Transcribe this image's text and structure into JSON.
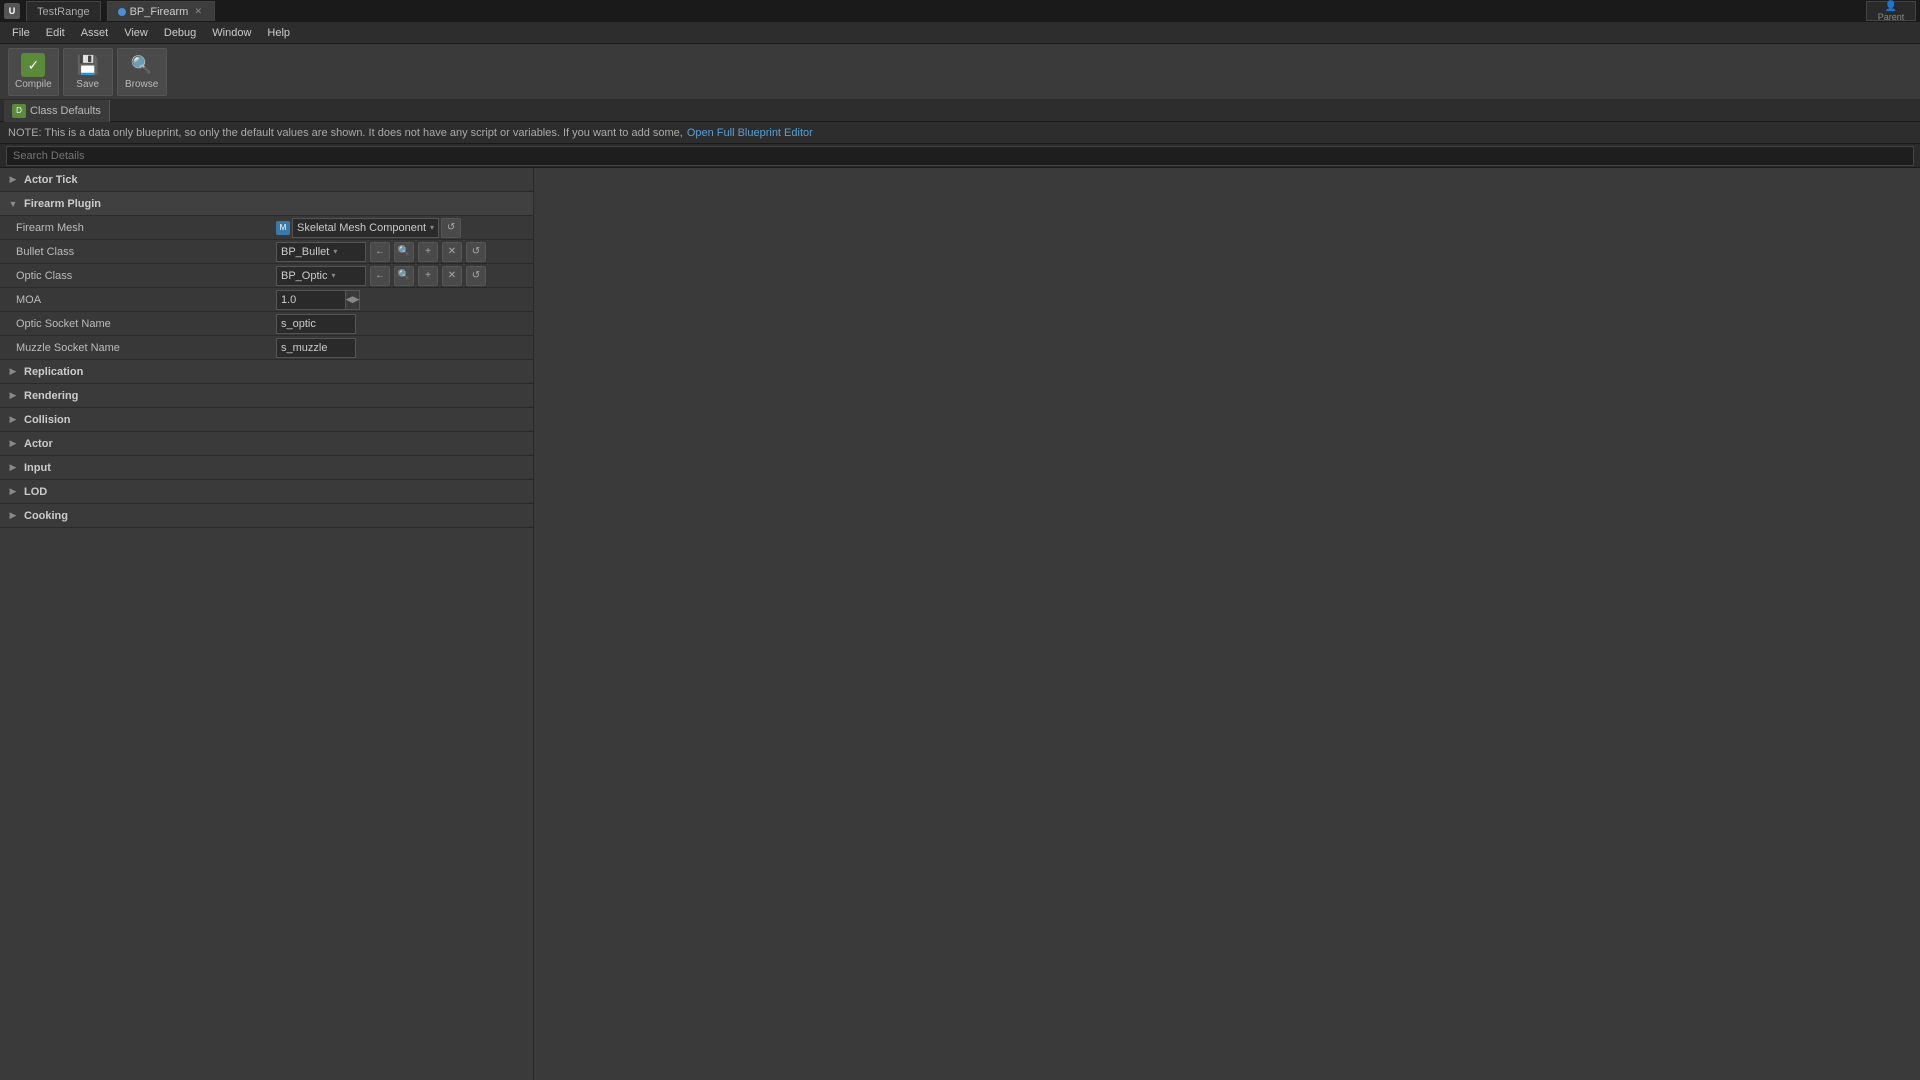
{
  "titlebar": {
    "logo": "U",
    "tabs": [
      {
        "label": "TestRange",
        "active": false,
        "dot": false
      },
      {
        "label": "BP_Firearm",
        "active": true,
        "dot": true
      }
    ],
    "parent_label": "Parent"
  },
  "menubar": {
    "items": [
      "File",
      "Edit",
      "Asset",
      "View",
      "Debug",
      "Window",
      "Help"
    ]
  },
  "toolbar": {
    "compile_label": "Compile",
    "save_label": "Save",
    "browse_label": "Browse"
  },
  "tabbar": {
    "tab_label": "Class Defaults"
  },
  "note": {
    "text_before": "NOTE: This is a data only blueprint, so only the default values are shown.  It does not have any script or variables.  If you want to add some,",
    "link_text": "Open Full Blueprint Editor",
    "text_after": ""
  },
  "search": {
    "placeholder": "Search Details"
  },
  "sections": [
    {
      "label": "Actor Tick",
      "expanded": false,
      "properties": []
    },
    {
      "label": "Firearm Plugin",
      "expanded": true,
      "properties": [
        {
          "key": "firearm_mesh",
          "label": "Firearm Mesh",
          "type": "dropdown_mesh",
          "value": "Skeletal Mesh Component"
        },
        {
          "key": "bullet_class",
          "label": "Bullet Class",
          "type": "dropdown_class",
          "value": "BP_Bullet"
        },
        {
          "key": "optic_class",
          "label": "Optic Class",
          "type": "dropdown_class",
          "value": "BP_Optic"
        },
        {
          "key": "moa",
          "label": "MOA",
          "type": "number",
          "value": "1.0"
        },
        {
          "key": "optic_socket_name",
          "label": "Optic Socket Name",
          "type": "text",
          "value": "s_optic"
        },
        {
          "key": "muzzle_socket_name",
          "label": "Muzzle Socket Name",
          "type": "text",
          "value": "s_muzzle"
        }
      ]
    },
    {
      "label": "Replication",
      "expanded": false,
      "properties": []
    },
    {
      "label": "Rendering",
      "expanded": false,
      "properties": []
    },
    {
      "label": "Collision",
      "expanded": false,
      "properties": []
    },
    {
      "label": "Actor",
      "expanded": false,
      "properties": []
    },
    {
      "label": "Input",
      "expanded": false,
      "properties": []
    },
    {
      "label": "LOD",
      "expanded": false,
      "properties": []
    },
    {
      "label": "Cooking",
      "expanded": false,
      "properties": []
    }
  ],
  "icons": {
    "arrow_right": "▶",
    "arrow_down": "▼",
    "gear": "⚙",
    "save": "💾",
    "browse": "🔍",
    "compile": "✓",
    "mesh": "M",
    "tab_cd": "D",
    "arrow_left": "←",
    "search": "🔍",
    "plus": "+",
    "cross": "✕",
    "undo": "↺",
    "dropdown": "▾"
  }
}
